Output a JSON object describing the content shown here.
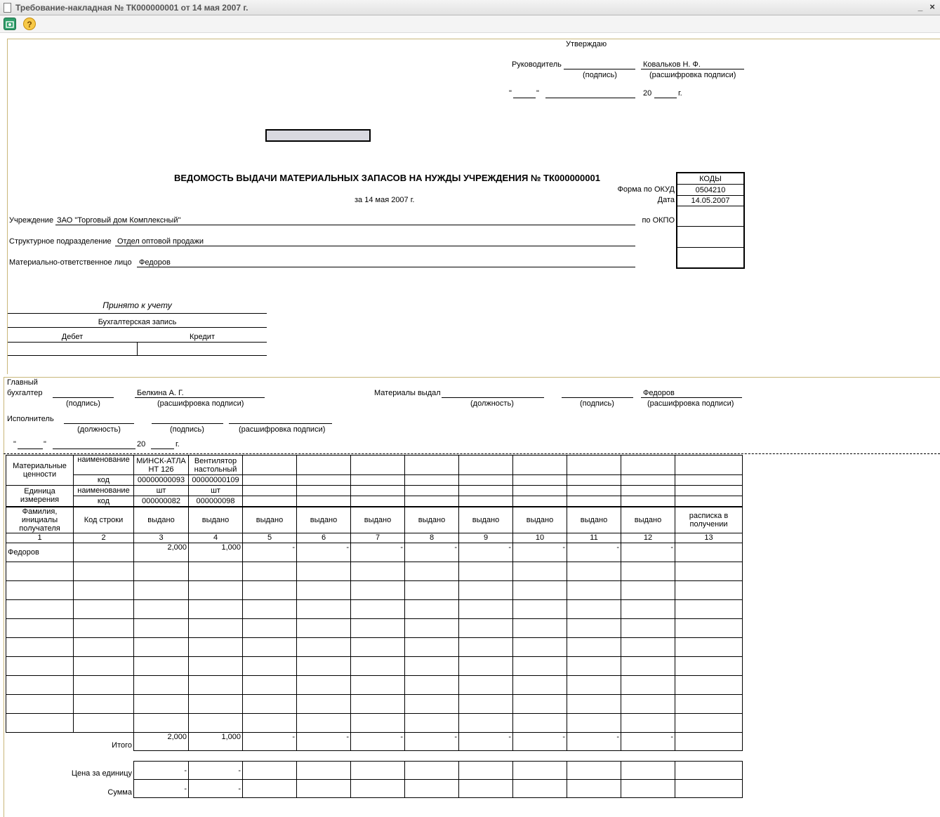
{
  "window": {
    "title": "Требование-накладная № ТК000000001 от 14 мая 2007 г.",
    "minimize_glyph": "_",
    "close_glyph": "×",
    "help_glyph": "?"
  },
  "approval": {
    "approve": "Утверждаю",
    "head_label": "Руководитель",
    "head_name": "Ковальков  Н. Ф.",
    "signature_hint": "(подпись)",
    "decoding_hint": "(расшифровка подписи)",
    "quote_open": "\"",
    "quote_close": "\"",
    "year_prefix": "20",
    "year_suffix": "г."
  },
  "report": {
    "title": "ВЕДОМОСТЬ ВЫДАЧИ МАТЕРИАЛЬНЫХ ЗАПАСОВ НА НУЖДЫ УЧРЕЖДЕНИЯ № ТК000000001",
    "date_line": "за 14 мая 2007 г.",
    "institution_label": "Учреждение",
    "institution": "ЗАО \"Торговый дом Комплексный\"",
    "department_label": "Структурное подразделение",
    "department": "Отдел оптовой продажи",
    "responsible_label": "Материально-ответственное лицо",
    "responsible": "Федоров"
  },
  "codes": {
    "header": "КОДЫ",
    "okud_label": "Форма по ОКУД",
    "okud": "0504210",
    "date_label": "Дата",
    "date": "14.05.2007",
    "okpo_label": "по ОКПО"
  },
  "accounting": {
    "accepted": "Принято к учету",
    "entry": "Бухгалтерская запись",
    "debit": "Дебет",
    "credit": "Кредит"
  },
  "signatures": {
    "chief_accountant_1": "Главный",
    "chief_accountant_2": "бухгалтер",
    "chief_name": "Белкина А. Г.",
    "signature_hint": "(подпись)",
    "decoding_hint": "(расшифровка подписи)",
    "position_hint": "(должность)",
    "issued_label": "Материалы выдал",
    "issued_name": "Федоров",
    "executor_label": "Исполнитель",
    "quote_open": "\"",
    "quote_close": "\"",
    "year_prefix": "20",
    "year_suffix": "г."
  },
  "table": {
    "mat_values": "Материальные ценности",
    "name_label": "наименование",
    "code_label": "код",
    "unit": "Единица измерения",
    "items": [
      {
        "name": "МИНСК-АТЛА НТ 126",
        "code": "00000000093",
        "unit": "шт",
        "unit_code": "000000082"
      },
      {
        "name": "Вентилятор настольный",
        "code": "00000000109",
        "unit": "шт",
        "unit_code": "000000098"
      }
    ],
    "col_recipient": "Фамилия, инициалы получателя",
    "col_line_code": "Код строки",
    "col_issued": "выдано",
    "col_receipt": "расписка в получении",
    "col_numbers": [
      "1",
      "2",
      "3",
      "4",
      "5",
      "6",
      "7",
      "8",
      "9",
      "10",
      "11",
      "12",
      "13"
    ],
    "rows": [
      {
        "recipient": "Федоров",
        "line_code": "",
        "values": [
          "2,000",
          "1,000",
          "-",
          "-",
          "-",
          "-",
          "-",
          "-",
          "-",
          "-"
        ]
      }
    ],
    "total_label": "Итого",
    "totals": [
      "2,000",
      "1,000",
      "-",
      "-",
      "-",
      "-",
      "-",
      "-",
      "-",
      "-"
    ],
    "price_label": "Цена за единицу",
    "prices": [
      "-",
      "-"
    ],
    "sum_label": "Сумма",
    "sums": [
      "-",
      "-"
    ]
  }
}
